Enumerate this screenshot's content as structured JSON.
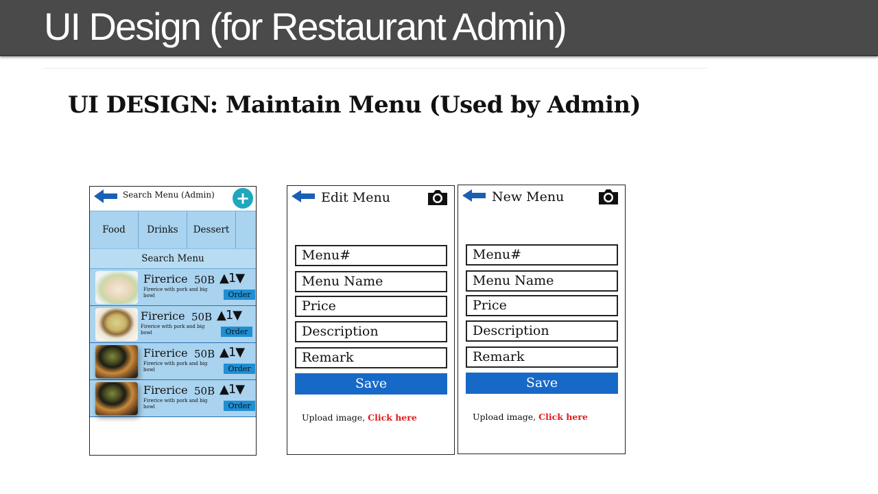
{
  "slide": {
    "title": "UI Design (for Restaurant Admin)",
    "subtitle": "UI DESIGN: Maintain Menu (Used by Admin)"
  },
  "search_screen": {
    "title": "Search Menu (Admin)",
    "add_label": "+",
    "tabs": [
      "Food",
      "Drinks",
      "Dessert"
    ],
    "search_label": "Search Menu",
    "items": [
      {
        "name": "Firerice",
        "price": "50B",
        "qty": "▲1▼",
        "description": "Firerice with pork and big bowl",
        "order_label": "Order"
      },
      {
        "name": "Firerice",
        "price": "50B",
        "qty": "▲1▼",
        "description": "Firerice with pork and big bowl",
        "order_label": "Order"
      },
      {
        "name": "Firerice",
        "price": "50B",
        "qty": "▲1▼",
        "description": "Firerice with pork and big bowl",
        "order_label": "Order"
      },
      {
        "name": "Firerice",
        "price": "50B",
        "qty": "▲1▼",
        "description": "Firerice with pork and big bowl",
        "order_label": "Order"
      }
    ]
  },
  "edit_screen": {
    "title": "Edit Menu",
    "fields": [
      "Menu#",
      "Menu Name",
      "Price",
      "Description",
      "Remark"
    ],
    "save_label": "Save",
    "upload_text": "Upload image, ",
    "upload_link": "Click here"
  },
  "new_screen": {
    "title": "New Menu",
    "fields": [
      "Menu#",
      "Menu Name",
      "Price",
      "Description",
      "Remark"
    ],
    "save_label": "Save",
    "upload_text": "Upload image, ",
    "upload_link": "Click here"
  },
  "colors": {
    "title_bar": "#4a4a4a",
    "accent_blue": "#1769c7",
    "list_background": "#a9d3ef",
    "add_button": "#1fa7bf",
    "link_red": "#e11a1a"
  },
  "icons": [
    "back-arrow-icon",
    "plus-icon",
    "camera-icon"
  ]
}
